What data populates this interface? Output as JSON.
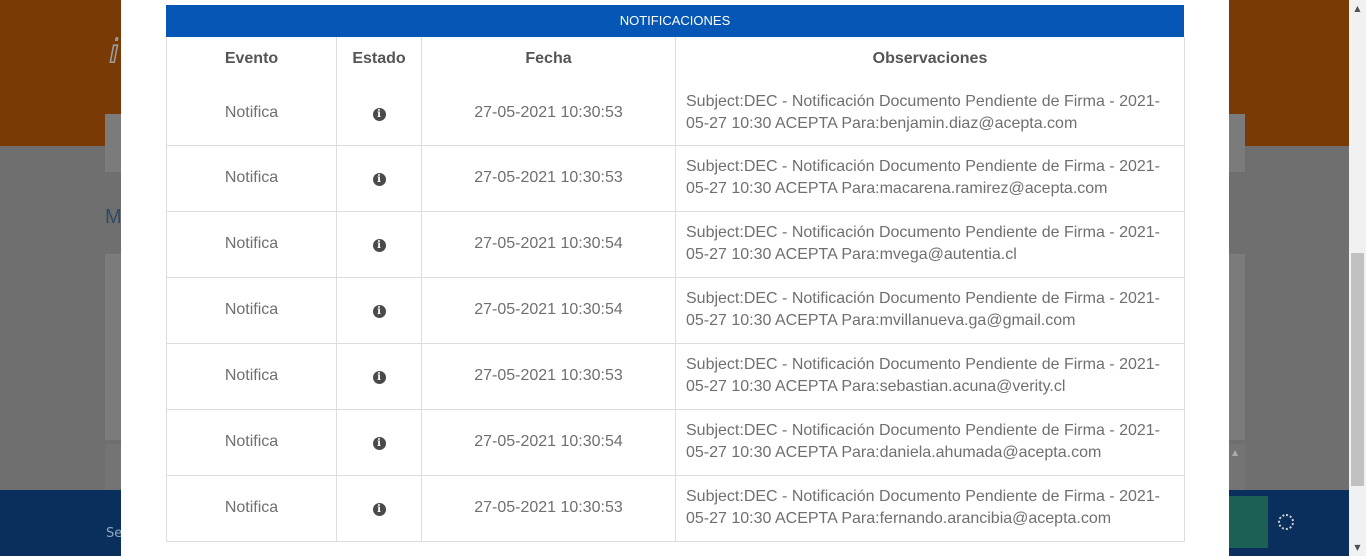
{
  "modal": {
    "title": "NOTIFICACIONES",
    "columns": [
      "Evento",
      "Estado",
      "Fecha",
      "Observaciones"
    ],
    "rows": [
      {
        "evento": "Notifica",
        "estado_icon": "info-icon",
        "fecha": "27-05-2021 10:30:53",
        "observaciones": "Subject:DEC - Notificación Documento Pendiente de Firma - 2021-05-27 10:30 ACEPTA Para:benjamin.diaz@acepta.com"
      },
      {
        "evento": "Notifica",
        "estado_icon": "info-icon",
        "fecha": "27-05-2021 10:30:53",
        "observaciones": "Subject:DEC - Notificación Documento Pendiente de Firma - 2021-05-27 10:30 ACEPTA Para:macarena.ramirez@acepta.com"
      },
      {
        "evento": "Notifica",
        "estado_icon": "info-icon",
        "fecha": "27-05-2021 10:30:54",
        "observaciones": "Subject:DEC - Notificación Documento Pendiente de Firma - 2021-05-27 10:30 ACEPTA Para:mvega@autentia.cl"
      },
      {
        "evento": "Notifica",
        "estado_icon": "info-icon",
        "fecha": "27-05-2021 10:30:54",
        "observaciones": "Subject:DEC - Notificación Documento Pendiente de Firma - 2021-05-27 10:30 ACEPTA Para:mvillanueva.ga@gmail.com"
      },
      {
        "evento": "Notifica",
        "estado_icon": "info-icon",
        "fecha": "27-05-2021 10:30:53",
        "observaciones": "Subject:DEC - Notificación Documento Pendiente de Firma - 2021-05-27 10:30 ACEPTA Para:sebastian.acuna@verity.cl"
      },
      {
        "evento": "Notifica",
        "estado_icon": "info-icon",
        "fecha": "27-05-2021 10:30:54",
        "observaciones": "Subject:DEC - Notificación Documento Pendiente de Firma - 2021-05-27 10:30 ACEPTA Para:daniela.ahumada@acepta.com"
      },
      {
        "evento": "Notifica",
        "estado_icon": "info-icon",
        "fecha": "27-05-2021 10:30:53",
        "observaciones": "Subject:DEC - Notificación Documento Pendiente de Firma - 2021-05-27 10:30 ACEPTA Para:fernando.arancibia@acepta.com"
      }
    ]
  },
  "background": {
    "heading_fragment": "M",
    "footer_fragment": "Se"
  },
  "colors": {
    "title_bar": "#0656b5",
    "header_bg": "#e46f0c",
    "footer_bg": "#0d4f9e"
  }
}
